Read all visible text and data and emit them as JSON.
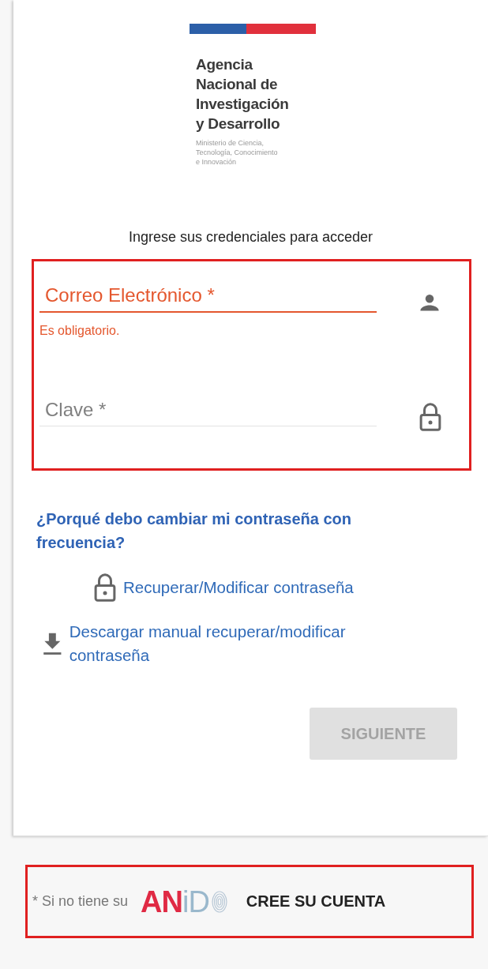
{
  "logo": {
    "lines": [
      "Agencia",
      "Nacional de",
      "Investigación",
      "y Desarrollo"
    ],
    "ministry": [
      "Ministerio de Ciencia,",
      "Tecnología, Conocimiento",
      "e Innovación"
    ]
  },
  "heading": "Ingrese sus credenciales para acceder",
  "fields": [
    {
      "kind": "user",
      "label": "Correo Electrónico *",
      "error": true,
      "error_text": "Es obligatorio."
    },
    {
      "kind": "lock",
      "label": "Clave *",
      "error": false
    }
  ],
  "faq_link": "¿Porqué debo cambiar mi contraseña con frecuencia?",
  "links": [
    {
      "kind": "lock",
      "text": "Recuperar/Modificar contraseña"
    },
    {
      "kind": "download",
      "text": "Descargar manual recuperar/modificar contraseña"
    }
  ],
  "next_button": {
    "label": "SIGUIENTE",
    "disabled": true
  },
  "footer": {
    "note": "* Si no tiene su",
    "brand": [
      "AN",
      "iD"
    ],
    "action": "CREE SU CUENTA"
  }
}
